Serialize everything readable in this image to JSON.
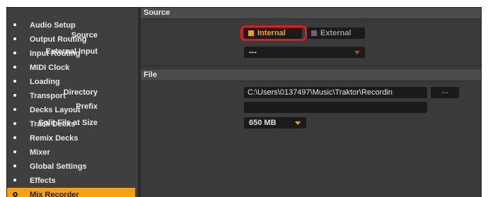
{
  "sidebar": {
    "items": [
      {
        "label": "Audio Setup"
      },
      {
        "label": "Output Routing"
      },
      {
        "label": "Input Routing"
      },
      {
        "label": "MIDI Clock"
      },
      {
        "label": "Loading"
      },
      {
        "label": "Transport"
      },
      {
        "label": "Decks Layout"
      },
      {
        "label": "Track Decks"
      },
      {
        "label": "Remix Decks"
      },
      {
        "label": "Mixer"
      },
      {
        "label": "Global Settings"
      },
      {
        "label": "Effects"
      },
      {
        "label": "Mix Recorder"
      }
    ],
    "active": "Mix Recorder"
  },
  "source_section": {
    "title": "Source",
    "source_label": "Source",
    "internal_label": "Internal",
    "external_label": "External",
    "selected": "Internal",
    "external_input_label": "External Input",
    "external_input_value": "---"
  },
  "file_section": {
    "title": "File",
    "directory_label": "Directory",
    "directory_value": "C:\\Users\\0137497\\Music\\Traktor\\Recordin",
    "browse_label": "...",
    "prefix_label": "Prefix",
    "prefix_value": "",
    "split_label": "Split File at Size",
    "split_value": "650 MB"
  },
  "colors": {
    "accent": "#f4a112",
    "highlight": "#e3191b",
    "panel": "#3a3a3a",
    "field": "#1b1b1b"
  }
}
